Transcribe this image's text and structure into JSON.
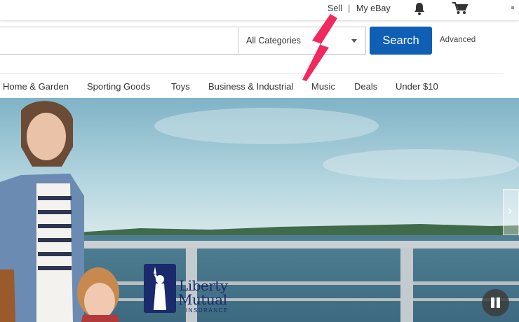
{
  "header": {
    "sell": "Sell",
    "separator": "|",
    "my_ebay": "My eBay"
  },
  "search": {
    "category": "All Categories",
    "button": "Search",
    "advanced": "Advanced"
  },
  "categories": [
    "Home & Garden",
    "Sporting Goods",
    "Toys",
    "Business & Industrial",
    "Music",
    "Deals",
    "Under $10"
  ],
  "hero": {
    "logo_line1": "Liberty",
    "logo_line2": "Mutual",
    "logo_line3": "INSURANCE"
  },
  "colors": {
    "search_button": "#0f5fb5",
    "annotation_arrow": "#f0295f",
    "logo": "#1a2a6c"
  }
}
